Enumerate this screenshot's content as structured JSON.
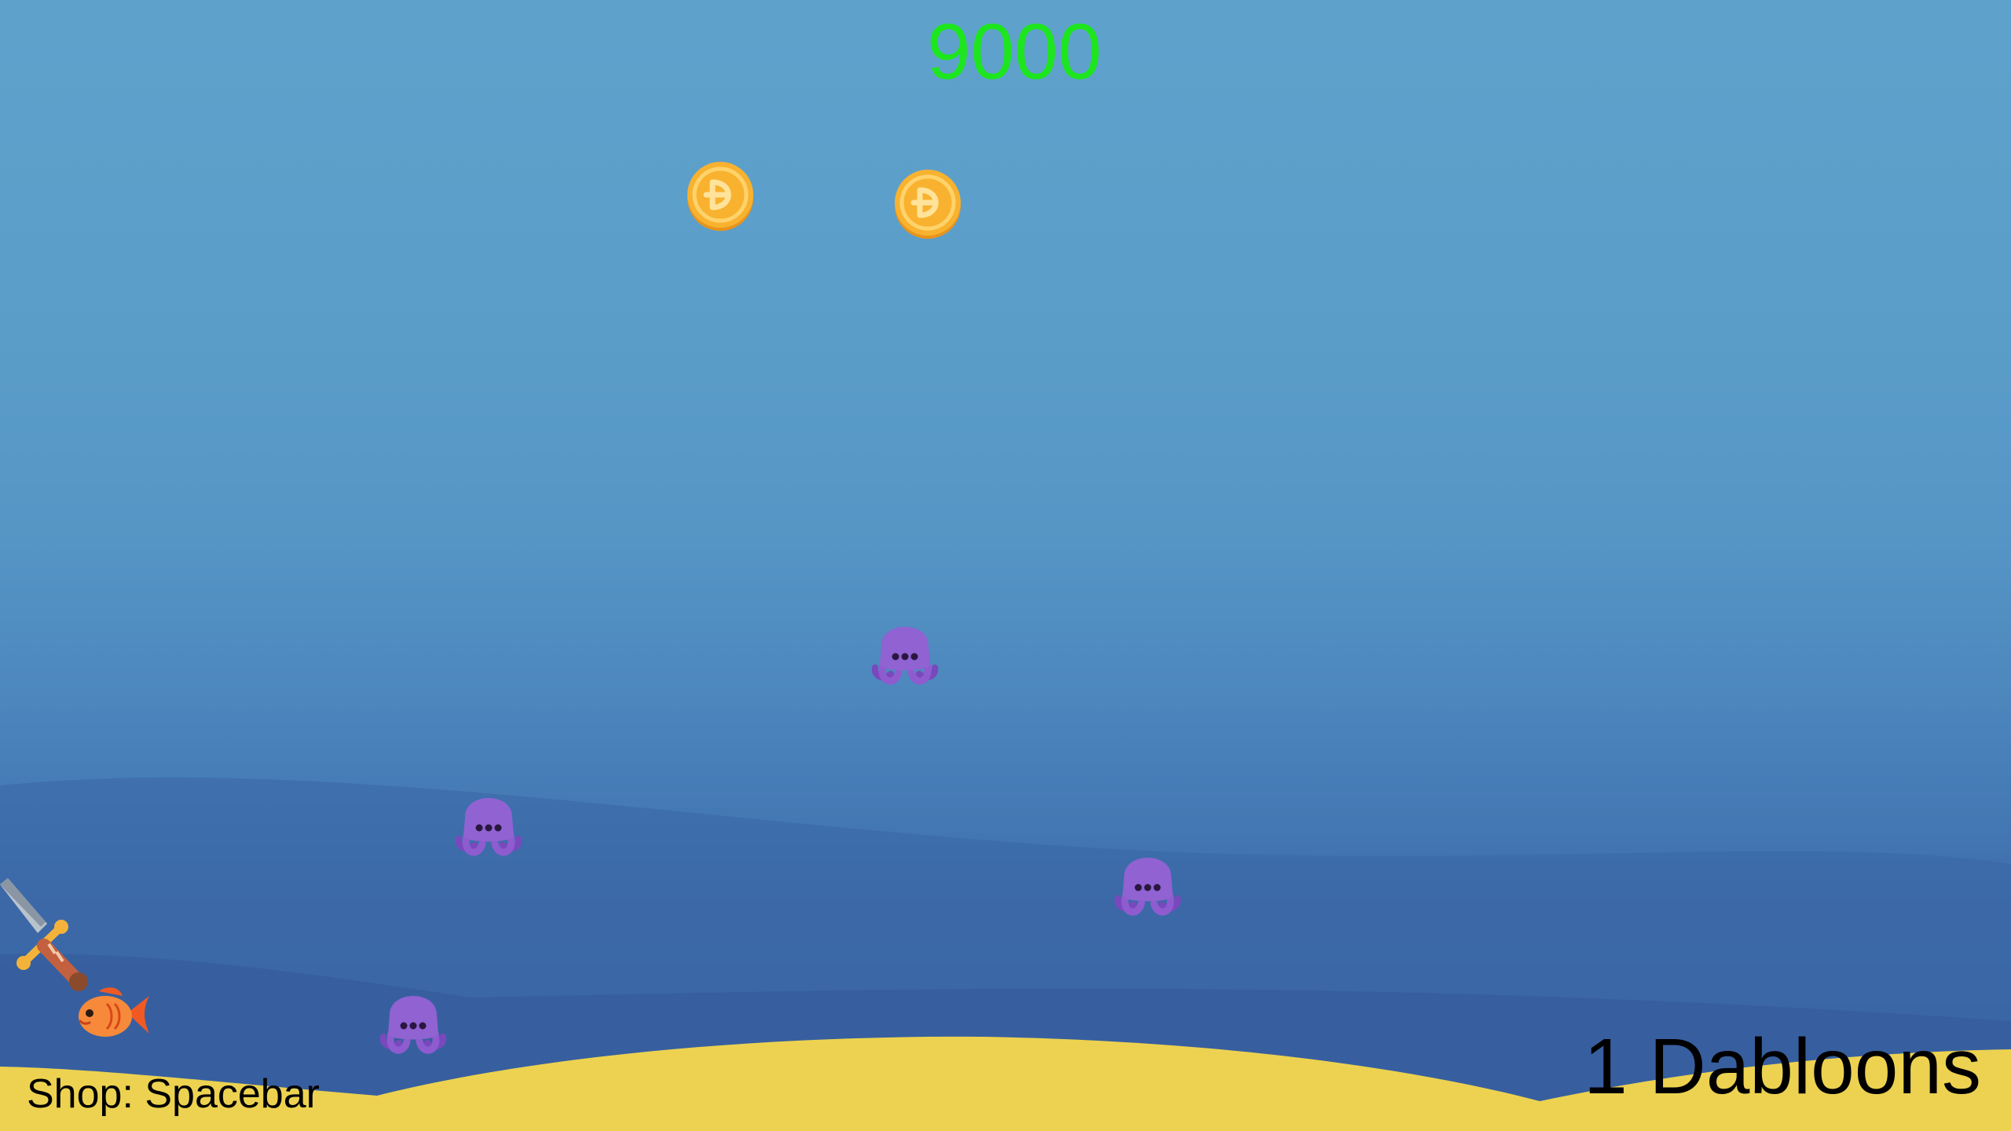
{
  "hud": {
    "score": "9000",
    "currency": "1 Dabloons",
    "shop_hint": "Shop: Spacebar"
  },
  "colors": {
    "score_text": "#1ee61e",
    "water_top": "#5ea2cc",
    "water_deep": "#3a62a2",
    "sand": "#ecd250",
    "coin": "#f5a623",
    "octopus": "#8e5ccf",
    "player_fish": "#f26b2a"
  },
  "sprites": {
    "coins": [
      "coin-icon",
      "coin-icon"
    ],
    "octopuses": [
      "octopus-icon",
      "octopus-icon",
      "octopus-icon",
      "octopus-icon"
    ],
    "player": "fish-icon",
    "weapon": "sword-icon"
  }
}
